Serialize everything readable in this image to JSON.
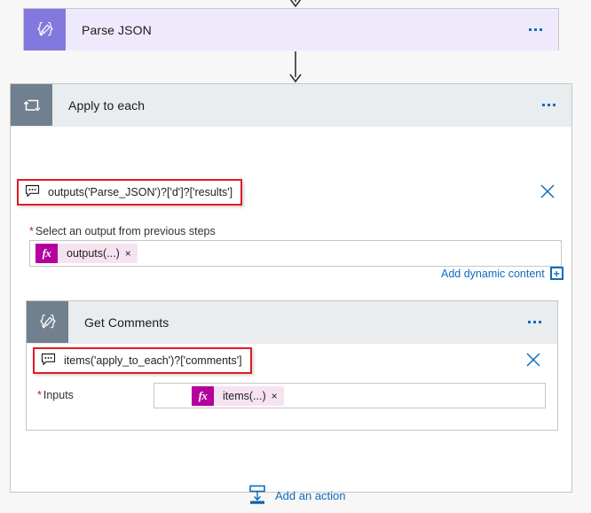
{
  "flow": {
    "parse_json": {
      "title": "Parse JSON",
      "icon": "braces-pencil-icon",
      "menu": "more-options-icon"
    },
    "apply_to_each": {
      "title": "Apply to each",
      "icon": "loop-icon",
      "menu": "more-options-icon",
      "expression_callout": "outputs('Parse_JSON')?['d']?['results']",
      "callout_icon": "speech-bubble-icon",
      "clear_icon": "close-icon",
      "field": {
        "required_mark": "*",
        "label": "Select an output from previous steps",
        "token": {
          "fx": "fx",
          "text": "outputs(...)",
          "remove": "×"
        }
      },
      "add_dynamic_content": {
        "label": "Add dynamic content",
        "plus": "+"
      }
    },
    "get_comments": {
      "title": "Get Comments",
      "icon": "braces-pencil-icon",
      "menu": "more-options-icon",
      "expression_callout": "items('apply_to_each')?['comments']",
      "callout_icon": "speech-bubble-icon",
      "clear_icon": "close-icon",
      "field": {
        "required_mark": "*",
        "label": "Inputs",
        "token": {
          "fx": "fx",
          "text": "items(...)",
          "remove": "×"
        }
      }
    },
    "add_action": {
      "label": "Add an action",
      "icon": "insert-action-icon"
    }
  },
  "colors": {
    "canvas": "#f7f7f7",
    "purple_icon": "#8378de",
    "purple_card": "#eeeafb",
    "control_icon": "#71808e",
    "control_card": "#e9edef",
    "link_blue": "#0f6cbd",
    "highlight_red": "#e01b24",
    "token_pink": "#f6e3f2",
    "fx_magenta": "#b4009e",
    "required_red": "#a4262c"
  }
}
